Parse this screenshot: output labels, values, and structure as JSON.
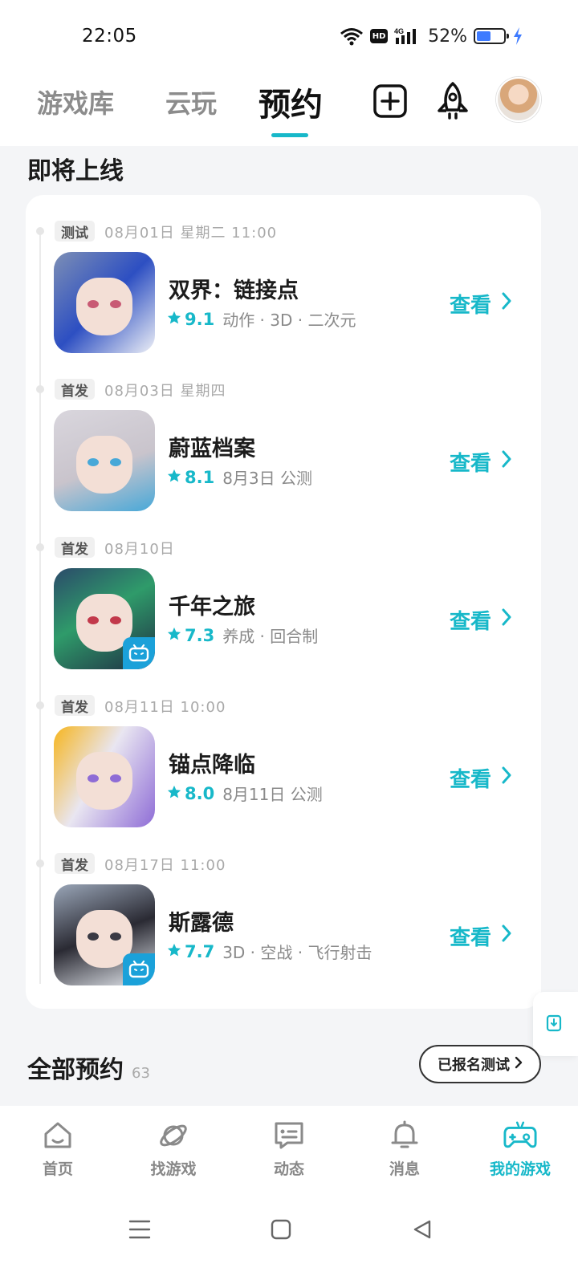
{
  "status_bar": {
    "time": "22:05",
    "network": "4G",
    "battery_percent": "52%",
    "battery_level": 0.52
  },
  "top_nav": {
    "tabs": [
      {
        "label": "游戏库",
        "active": false
      },
      {
        "label": "云玩",
        "active": false
      },
      {
        "label": "预约",
        "active": true
      }
    ],
    "icons": [
      "add-square-icon",
      "rocket-icon",
      "avatar"
    ]
  },
  "colors": {
    "accent": "#17b8c9",
    "text_primary": "#1b1b1b",
    "text_secondary": "#8a8a8a",
    "background": "#f4f5f7"
  },
  "upcoming": {
    "title": "即将上线",
    "items": [
      {
        "badge": "测试",
        "date": "08月01日  星期二  11:00",
        "name": "双界：链接点",
        "rating": "9.1",
        "tags": "动作 · 3D · 二次元",
        "action": "查看",
        "platform_badge": false,
        "palette": [
          "#7d8fb5",
          "#2d4fc2",
          "#eef0f6"
        ]
      },
      {
        "badge": "首发",
        "date": "08月03日  星期四",
        "name": "蔚蓝档案",
        "rating": "8.1",
        "tags": "8月3日  公测",
        "action": "查看",
        "platform_badge": false,
        "palette": [
          "#d9d6dd",
          "#c9c4cc",
          "#47a8d8"
        ]
      },
      {
        "badge": "首发",
        "date": "08月10日",
        "name": "千年之旅",
        "rating": "7.3",
        "tags": "养成 · 回合制",
        "action": "查看",
        "platform_badge": true,
        "palette": [
          "#2b4a6a",
          "#2f9b6a",
          "#1f2d44"
        ]
      },
      {
        "badge": "首发",
        "date": "08月11日  10:00",
        "name": "锚点降临",
        "rating": "8.0",
        "tags": "8月11日  公测",
        "action": "查看",
        "platform_badge": false,
        "palette": [
          "#f6b51e",
          "#e9e6f1",
          "#8e6cd6"
        ]
      },
      {
        "badge": "首发",
        "date": "08月17日  11:00",
        "name": "斯露德",
        "rating": "7.7",
        "tags": "3D · 空战 · 飞行射击",
        "action": "查看",
        "platform_badge": true,
        "palette": [
          "#9aa6b8",
          "#2a2a33",
          "#e8ecf2"
        ]
      }
    ]
  },
  "all_reservations": {
    "title": "全部预约",
    "count": "63",
    "registered_button": "已报名测试"
  },
  "bottom_nav": {
    "items": [
      {
        "label": "首页",
        "icon": "home-icon",
        "active": false
      },
      {
        "label": "找游戏",
        "icon": "planet-icon",
        "active": false
      },
      {
        "label": "动态",
        "icon": "message-icon",
        "active": false
      },
      {
        "label": "消息",
        "icon": "bell-icon",
        "active": false
      },
      {
        "label": "我的游戏",
        "icon": "gamepad-icon",
        "active": true
      }
    ]
  },
  "system_nav": {
    "buttons": [
      "menu-icon",
      "home-square-icon",
      "back-icon"
    ]
  }
}
